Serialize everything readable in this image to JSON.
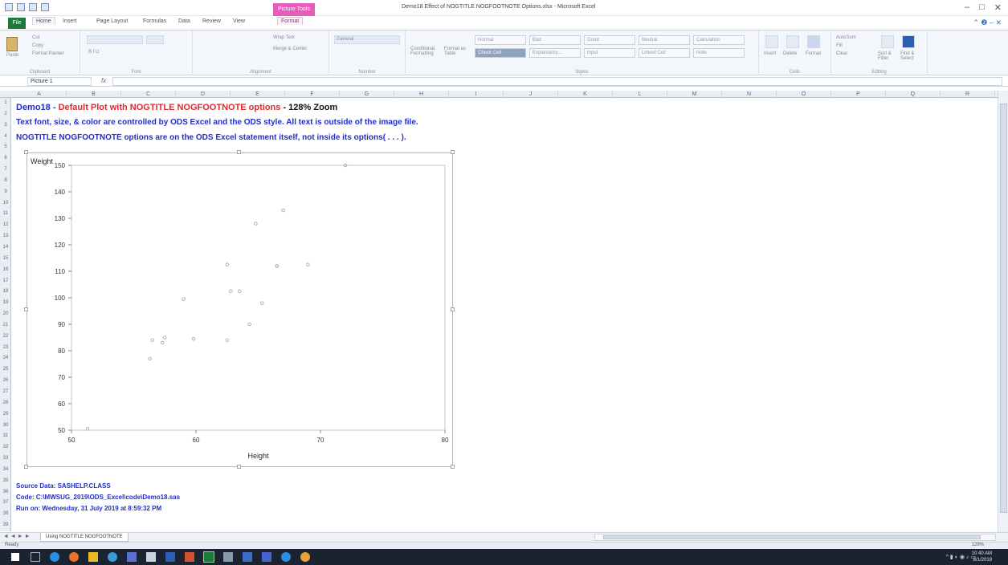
{
  "window": {
    "title": "Demo18 Effect of NOGTITLE NOGFOOTNOTE Options.xlsx - Microsoft Excel",
    "context_tab": "Picture Tools"
  },
  "tabs": [
    "File",
    "Home",
    "Insert",
    "Page Layout",
    "Formulas",
    "Data",
    "Review",
    "View",
    "Format"
  ],
  "ribbon": {
    "groups": [
      "Clipboard",
      "Font",
      "Alignment",
      "Number",
      "Styles",
      "Cells",
      "Editing"
    ],
    "clipboard": {
      "cut": "Cut",
      "copy": "Copy",
      "format_painter": "Format Painter",
      "paste": "Paste"
    },
    "alignment": {
      "wrap_text": "Wrap Text",
      "merge_center": "Merge & Center"
    },
    "number": {
      "format": "General"
    },
    "styles": {
      "conditional_formatting": "Conditional Formatting",
      "format_as_table": "Format as Table",
      "cells": [
        "Normal",
        "Bad",
        "Good",
        "Neutral",
        "Calculation",
        "Check Cell",
        "Explanatory...",
        "Input",
        "Linked Cell",
        "Note"
      ]
    },
    "cells": {
      "insert": "Insert",
      "delete": "Delete",
      "format": "Format"
    },
    "editing": {
      "autosum": "AutoSum",
      "fill": "Fill",
      "clear": "Clear",
      "sort_filter": "Sort & Filter",
      "find_select": "Find & Select"
    }
  },
  "formula_bar": {
    "name_box": "Picture 1",
    "fx": "fx",
    "value": ""
  },
  "columns": [
    "A",
    "B",
    "C",
    "D",
    "E",
    "F",
    "G",
    "H",
    "I",
    "J",
    "K",
    "L",
    "M",
    "N",
    "O",
    "P",
    "Q",
    "R"
  ],
  "rows": [
    "1",
    "2",
    "3",
    "4",
    "5",
    "6",
    "7",
    "8",
    "9",
    "10",
    "11",
    "12",
    "13",
    "14",
    "15",
    "16",
    "17",
    "18",
    "19",
    "20",
    "21",
    "22",
    "23",
    "24",
    "25",
    "26",
    "27",
    "28",
    "29",
    "30",
    "31",
    "32",
    "33",
    "34",
    "35",
    "36",
    "37",
    "38",
    "39"
  ],
  "content": {
    "line1": {
      "part1": "Demo18 - ",
      "part2": "Default Plot with NOGTITLE NOGFOOTNOTE options",
      "part3": " - 128% Zoom"
    },
    "line2": "Text font, size, & color are controlled by ODS Excel and the ODS style. All text is outside of the image file.",
    "line3": "NOGTITLE NOGFOOTNOTE options are on the ODS Excel statement itself, not inside its options( . . . ).",
    "source": "Source Data: SASHELP.CLASS",
    "code": "Code: C:\\MWSUG_2019\\ODS_Excel\\code\\Demo18.sas",
    "run_on": "Run on: Wednesday, 31 July 2019 at 8:59:32 PM"
  },
  "chart_data": {
    "type": "scatter",
    "title": "",
    "xlabel": "Height",
    "ylabel": "Weight",
    "xlim": [
      50,
      80
    ],
    "ylim": [
      50,
      150
    ],
    "xticks": [
      50,
      60,
      70,
      80
    ],
    "yticks": [
      50,
      60,
      70,
      80,
      90,
      100,
      110,
      120,
      130,
      140,
      150
    ],
    "points": [
      [
        69.0,
        112.5
      ],
      [
        56.5,
        84.0
      ],
      [
        65.3,
        98.0
      ],
      [
        62.8,
        102.5
      ],
      [
        63.5,
        102.5
      ],
      [
        57.3,
        83.0
      ],
      [
        59.8,
        84.5
      ],
      [
        62.5,
        112.5
      ],
      [
        62.5,
        84.0
      ],
      [
        59.0,
        99.5
      ],
      [
        51.3,
        50.5
      ],
      [
        64.3,
        90.0
      ],
      [
        56.3,
        77.0
      ],
      [
        66.5,
        112.0
      ],
      [
        72.0,
        150.0
      ],
      [
        64.8,
        128.0
      ],
      [
        67.0,
        133.0
      ],
      [
        57.5,
        85.0
      ],
      [
        66.5,
        112.0
      ]
    ]
  },
  "sheet_tabs": {
    "nav": "◄ ◄ ► ►",
    "active": "Using NOGTITLE NOGFOOTNOTE"
  },
  "status": {
    "ready": "Ready",
    "zoom": "128%"
  },
  "clock": {
    "time": "10:40 AM",
    "date": "8/1/2019"
  },
  "colors": {
    "excel_green": "#1d7a3a",
    "blue_text": "#1f2ecb",
    "red_text": "#e02a2a",
    "picture_tools": "#e75cbc"
  }
}
